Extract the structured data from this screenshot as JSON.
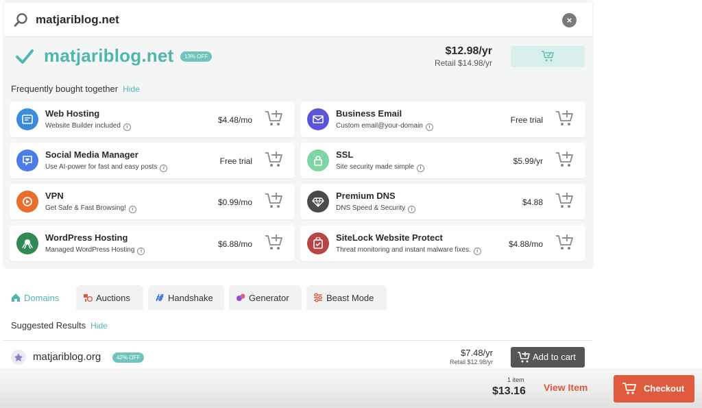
{
  "search": {
    "query": "matjariblog.net",
    "clear_icon": "×"
  },
  "selected": {
    "domain": "matjariblog.net",
    "badge": "13% OFF",
    "price": "$12.98/yr",
    "retail": "Retail $14.98/yr"
  },
  "fbt": {
    "title": "Frequently bought together",
    "hide": "Hide"
  },
  "products": [
    {
      "name": "Web Hosting",
      "desc": "Website Builder included",
      "price": "$4.48/mo",
      "color": "#3b8bd8",
      "icon": "browser-icon"
    },
    {
      "name": "Business Email",
      "desc": "Custom email@your-domain",
      "price": "Free trial",
      "color": "#5a55d8",
      "icon": "mail-icon"
    },
    {
      "name": "Social Media Manager",
      "desc": "Use AI-power for fast and easy posts",
      "price": "Free trial",
      "color": "#4d7be8",
      "icon": "heart-chat-icon"
    },
    {
      "name": "SSL",
      "desc": "Site security made simple",
      "price": "$5.99/yr",
      "color": "#7fd4a3",
      "icon": "lock-icon"
    },
    {
      "name": "VPN",
      "desc": "Get Safe & Fast Browsing!",
      "price": "$0.99/mo",
      "color": "#ea6d2e",
      "icon": "vpn-icon"
    },
    {
      "name": "Premium DNS",
      "desc": "DNS Speed & Security",
      "price": "$4.88",
      "color": "#4a4a4a",
      "icon": "diamond-icon"
    },
    {
      "name": "WordPress Hosting",
      "desc": "Managed WordPress Hosting",
      "price": "$6.88/mo",
      "color": "#2f8a55",
      "icon": "octopus-icon"
    },
    {
      "name": "SiteLock Website Protect",
      "desc": "Threat monitoring and instant malware fixes.",
      "price": "$4.88/mo",
      "color": "#b84545",
      "icon": "shield-check-icon"
    }
  ],
  "tabs": [
    {
      "label": "Domains",
      "icon": "house-icon",
      "color": "#4fb6ad"
    },
    {
      "label": "Auctions",
      "icon": "auction-icon",
      "color": "#e05a3e"
    },
    {
      "label": "Handshake",
      "icon": "handshake-icon",
      "color": "#3a6fe0"
    },
    {
      "label": "Generator",
      "icon": "generator-icon",
      "color": "#8a4fe0"
    },
    {
      "label": "Beast Mode",
      "icon": "sliders-icon",
      "color": "#e05a3e"
    }
  ],
  "suggested": {
    "title": "Suggested Results",
    "hide": "Hide"
  },
  "result": {
    "domain": "matjariblog.org",
    "badge": "42% OFF",
    "price": "$7.48/yr",
    "retail": "Retail $12.98/yr",
    "button": "Add to cart"
  },
  "footer": {
    "items": "1 item",
    "total": "$13.16",
    "view_item": "View Item",
    "checkout": "Checkout"
  }
}
